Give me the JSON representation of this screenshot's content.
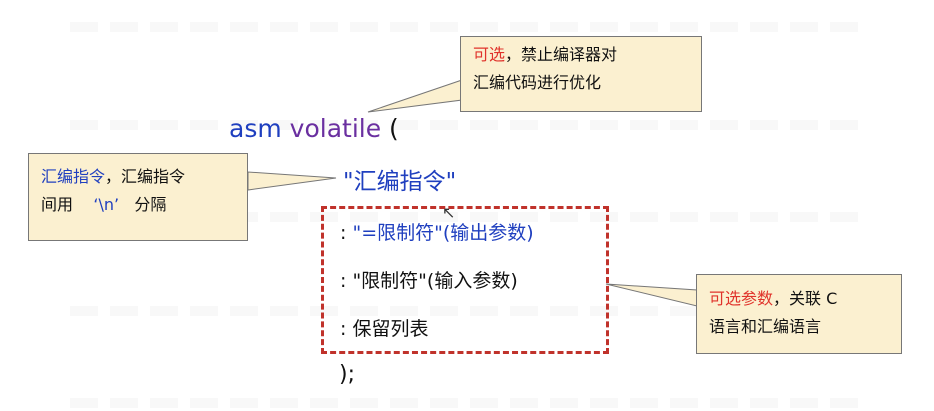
{
  "code": {
    "kw_asm": "asm",
    "kw_volatile": "volatile",
    "open_paren": "(",
    "instruction": "\"汇编指令\"",
    "output_colon": ": ",
    "output_constraint": "\"=限制符\"",
    "output_param": "(输出参数)",
    "input_line": ": \"限制符\"(输入参数)",
    "clobber_line": ": 保留列表",
    "close": ");"
  },
  "notes": {
    "optional_top": {
      "highlight": "可选",
      "sep": "，",
      "rest1": "禁止编译器对",
      "line2": "汇编代码进行优化"
    },
    "instruction": {
      "highlight": "汇编指令",
      "rest1": "，汇编指令",
      "line2a": "间用",
      "escape": "‘\\n’",
      "line2b": "分隔"
    },
    "params": {
      "highlight": "可选参数",
      "rest1": "，关联 C",
      "line2": "语言和汇编语言"
    }
  },
  "colors": {
    "keyword": "#1f3fbf",
    "volatile": "#6a2fa0",
    "highlight": "#e0332b",
    "note_bg": "#fbf0d0",
    "dash_border": "#c0322b"
  }
}
